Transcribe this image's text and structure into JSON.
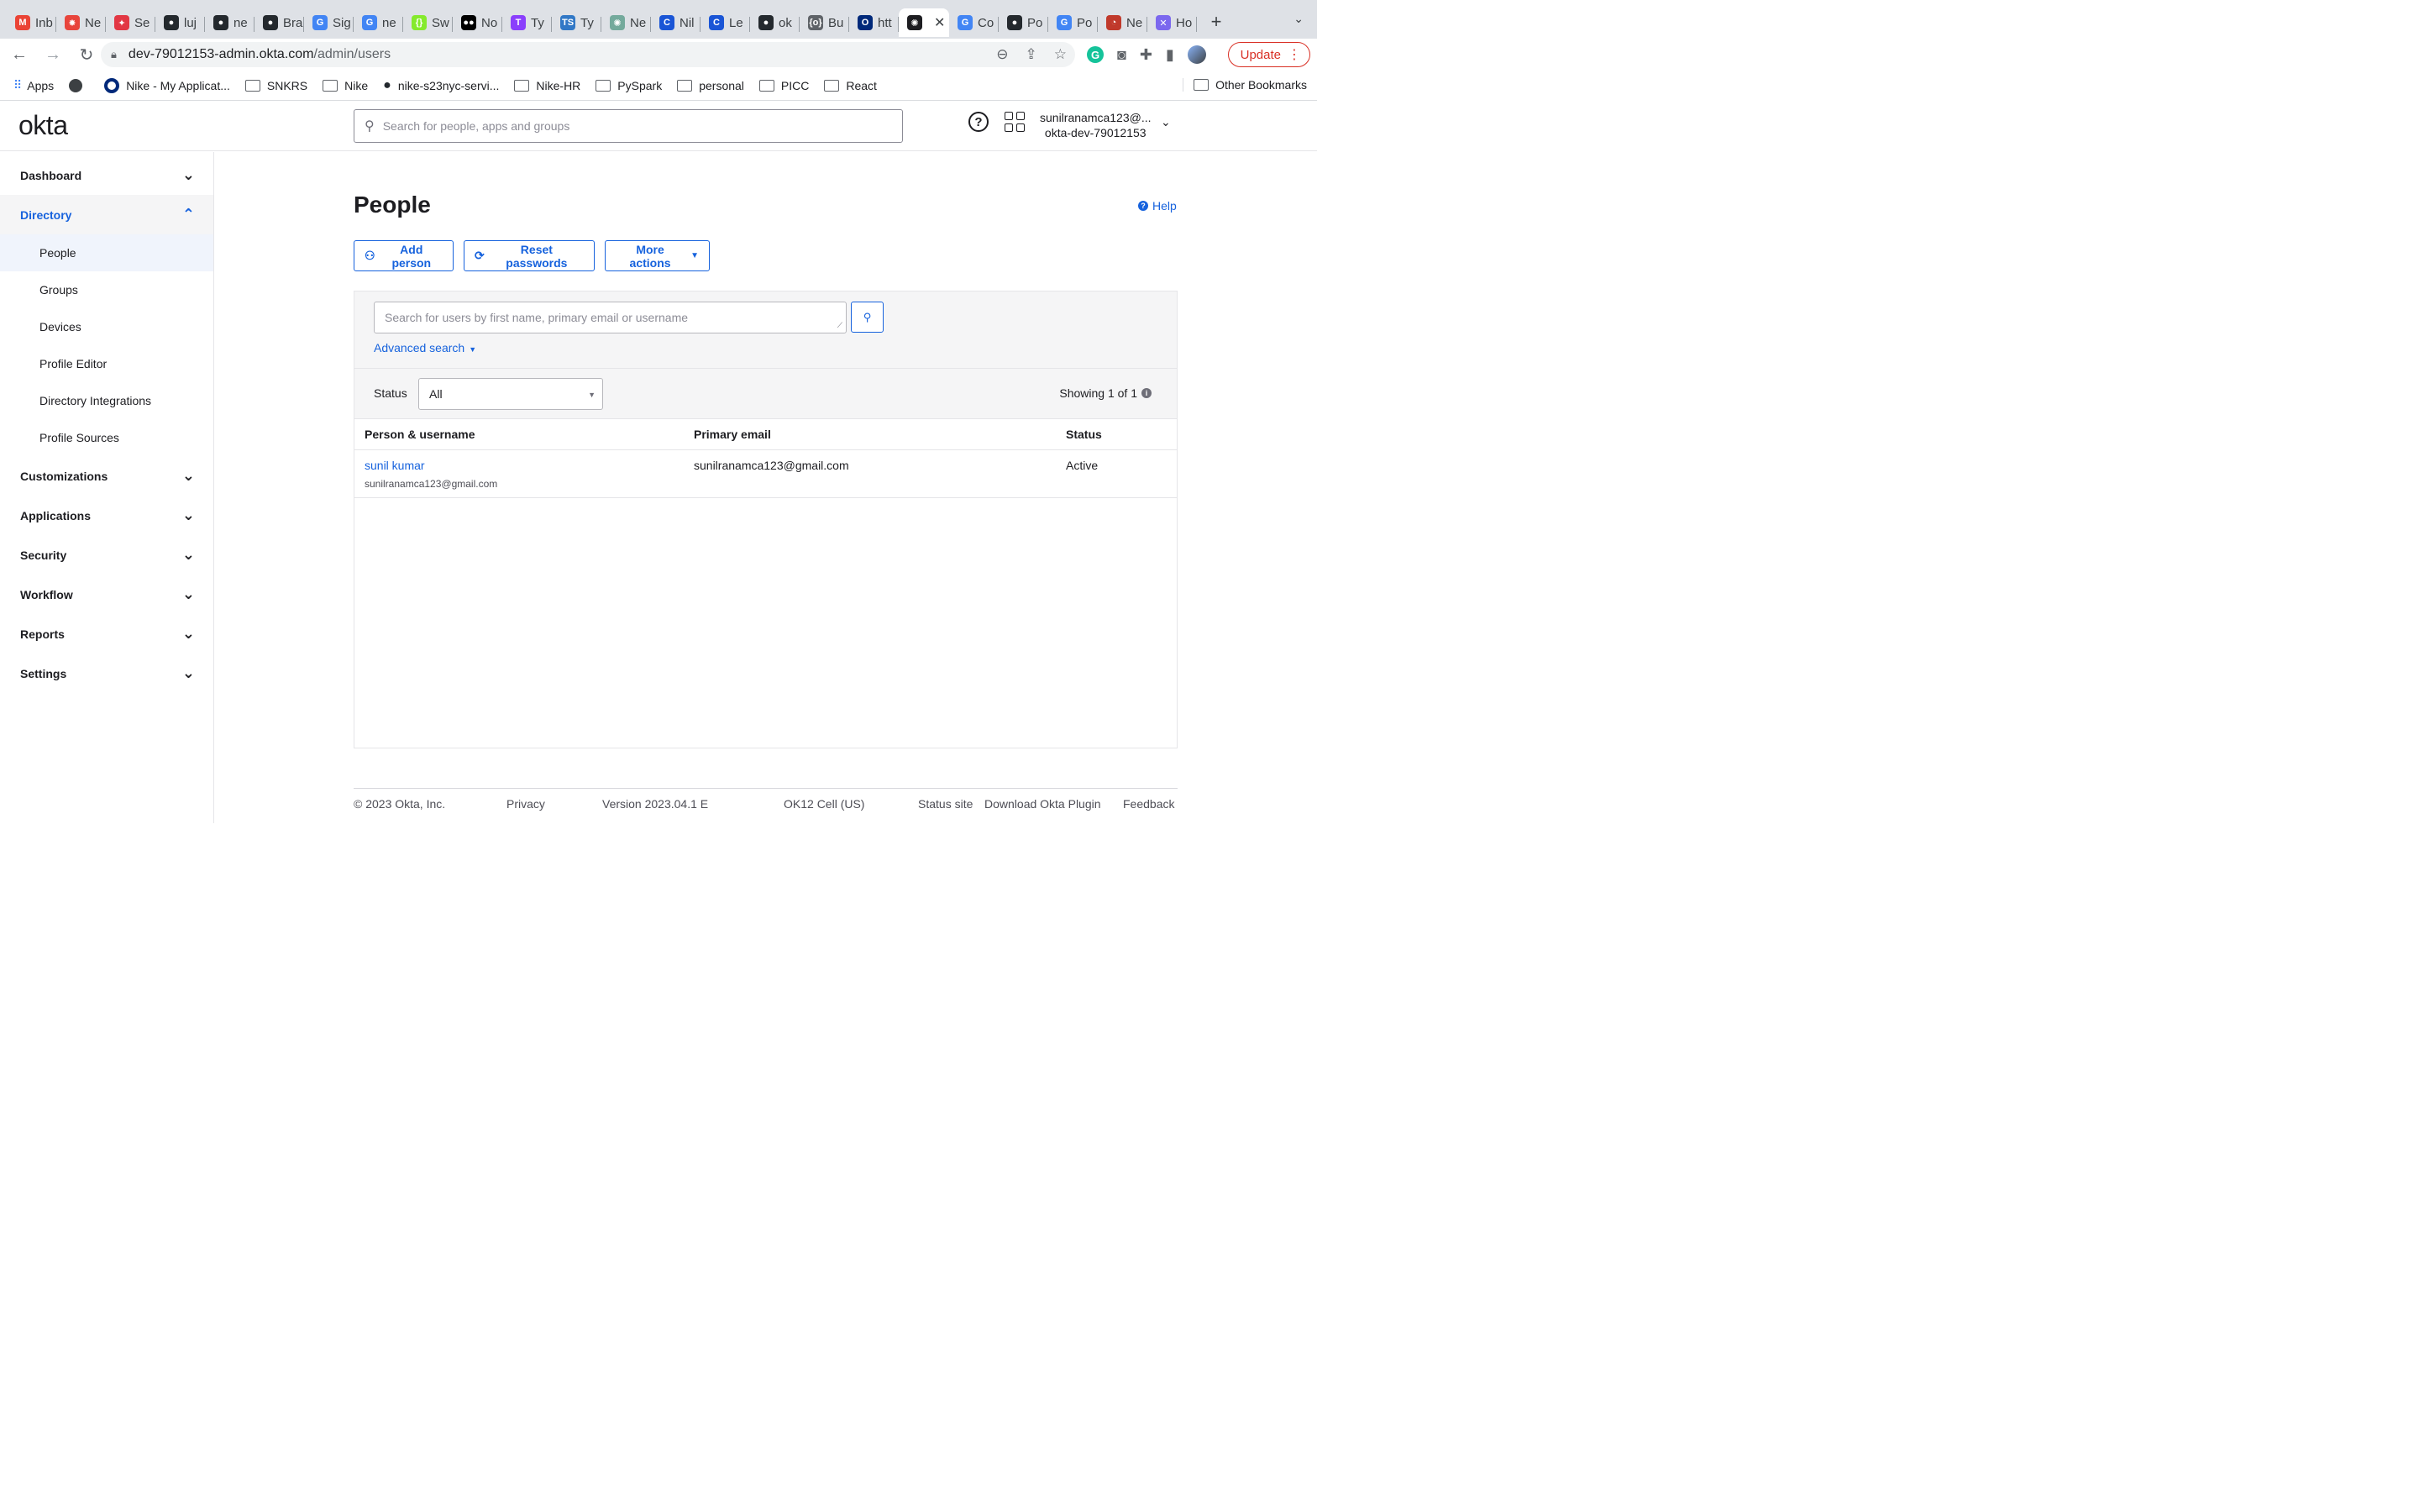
{
  "browser": {
    "tabs": [
      {
        "label": "Inb",
        "icon": "gmail-icon",
        "color": "#ea4335",
        "glyph": "M"
      },
      {
        "label": "Ne",
        "icon": "starburst-icon",
        "color": "#e8453c",
        "glyph": "✸"
      },
      {
        "label": "Se",
        "icon": "bird-icon",
        "color": "#e23744",
        "glyph": "✦"
      },
      {
        "label": "luj",
        "icon": "github-icon",
        "color": "#24292e",
        "glyph": "●"
      },
      {
        "label": "ne",
        "icon": "github-icon",
        "color": "#24292e",
        "glyph": "●"
      },
      {
        "label": "Bra",
        "icon": "github-icon",
        "color": "#24292e",
        "glyph": "●"
      },
      {
        "label": "Sig",
        "icon": "google-icon",
        "color": "#4285f4",
        "glyph": "G"
      },
      {
        "label": "ne",
        "icon": "google-icon",
        "color": "#4285f4",
        "glyph": "G"
      },
      {
        "label": "Sw",
        "icon": "swagger-icon",
        "color": "#85ea2d",
        "glyph": "{}"
      },
      {
        "label": "No",
        "icon": "medium-icon",
        "color": "#000000",
        "glyph": "●●"
      },
      {
        "label": "Ty",
        "icon": "typing-icon",
        "color": "#8a3ffc",
        "glyph": "T"
      },
      {
        "label": "Ty",
        "icon": "typescript-icon",
        "color": "#3178c6",
        "glyph": "TS"
      },
      {
        "label": "Ne",
        "icon": "chatgpt-icon",
        "color": "#74aa9c",
        "glyph": "✺"
      },
      {
        "label": "Nil",
        "icon": "c-icon",
        "color": "#1a55d6",
        "glyph": "C"
      },
      {
        "label": "Le",
        "icon": "c-icon",
        "color": "#1a55d6",
        "glyph": "C"
      },
      {
        "label": "ok",
        "icon": "github-icon",
        "color": "#24292e",
        "glyph": "●"
      },
      {
        "label": "Bu",
        "icon": "build-icon",
        "color": "#5f6368",
        "glyph": "{o}"
      },
      {
        "label": "htt",
        "icon": "okta-icon",
        "color": "#00297a",
        "glyph": "O"
      },
      {
        "label": "",
        "icon": "okta-sun-icon",
        "color": "#1d1d21",
        "glyph": "✺",
        "active": true
      },
      {
        "label": "Co",
        "icon": "google-icon",
        "color": "#4285f4",
        "glyph": "G"
      },
      {
        "label": "Po",
        "icon": "github-icon",
        "color": "#24292e",
        "glyph": "●"
      },
      {
        "label": "Po",
        "icon": "google-icon",
        "color": "#4285f4",
        "glyph": "G"
      },
      {
        "label": "Ne",
        "icon": "pie-icon",
        "color": "#c0392b",
        "glyph": "◔"
      },
      {
        "label": "Ho",
        "icon": "globe-icon",
        "color": "#7b68ee",
        "glyph": "✕"
      }
    ],
    "url_host": "dev-79012153-admin.okta.com",
    "url_path": "/admin/users",
    "update_label": "Update",
    "bookmarks": [
      {
        "label": "Apps",
        "icon": "apps-grid-icon"
      },
      {
        "label": "",
        "icon": "globe-icon"
      },
      {
        "label": "Nike - My Applicat...",
        "icon": "okta-icon"
      },
      {
        "label": "SNKRS",
        "icon": "folder-icon"
      },
      {
        "label": "Nike",
        "icon": "folder-icon"
      },
      {
        "label": "nike-s23nyc-servi...",
        "icon": "github-icon"
      },
      {
        "label": "Nike-HR",
        "icon": "folder-icon"
      },
      {
        "label": "PySpark",
        "icon": "folder-icon"
      },
      {
        "label": "personal",
        "icon": "folder-icon"
      },
      {
        "label": "PICC",
        "icon": "folder-icon"
      },
      {
        "label": "React",
        "icon": "folder-icon"
      }
    ],
    "other_bookmarks": "Other Bookmarks"
  },
  "header": {
    "logo": "okta",
    "search_placeholder": "Search for people, apps and groups",
    "user_email": "sunilranamca123@...",
    "user_org": "okta-dev-79012153"
  },
  "sidebar": {
    "sections": [
      {
        "label": "Dashboard",
        "expanded": false
      },
      {
        "label": "Directory",
        "expanded": true,
        "items": [
          "People",
          "Groups",
          "Devices",
          "Profile Editor",
          "Directory Integrations",
          "Profile Sources"
        ]
      },
      {
        "label": "Customizations",
        "expanded": false
      },
      {
        "label": "Applications",
        "expanded": false
      },
      {
        "label": "Security",
        "expanded": false
      },
      {
        "label": "Workflow",
        "expanded": false
      },
      {
        "label": "Reports",
        "expanded": false
      },
      {
        "label": "Settings",
        "expanded": false
      }
    ]
  },
  "page": {
    "title": "People",
    "help": "Help",
    "add_person": "Add person",
    "reset_passwords": "Reset passwords",
    "more_actions": "More actions",
    "user_search_placeholder": "Search for users by first name, primary email or username",
    "advanced_search": "Advanced search",
    "status_label": "Status",
    "status_value": "All",
    "showing": "Showing 1 of 1",
    "columns": [
      "Person & username",
      "Primary email",
      "Status"
    ],
    "rows": [
      {
        "name": "sunil kumar",
        "username": "sunilranamca123@gmail.com",
        "email": "sunilranamca123@gmail.com",
        "status": "Active"
      }
    ]
  },
  "footer": {
    "copyright": "© 2023 Okta, Inc.",
    "privacy": "Privacy",
    "version": "Version 2023.04.1 E",
    "cell": "OK12 Cell (US)",
    "status_site": "Status site",
    "download_plugin": "Download Okta Plugin",
    "feedback": "Feedback"
  },
  "colors": {
    "accent": "#1662dd",
    "update": "#d93025"
  }
}
